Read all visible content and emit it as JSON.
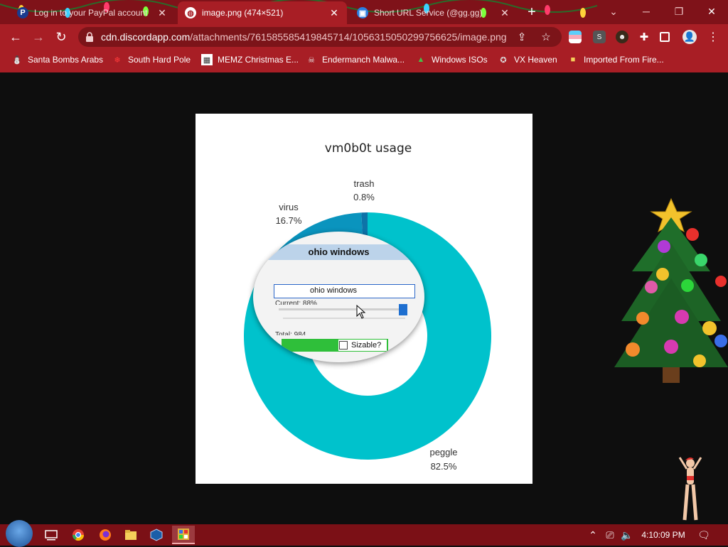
{
  "tabs": [
    {
      "title": "Log in to your PayPal account",
      "favicon": "paypal-favicon",
      "active": false
    },
    {
      "title": "image.png (474×521)",
      "favicon": "globe-favicon",
      "active": true
    },
    {
      "title": "Short URL Service (@gg.gg)",
      "favicon": "shorturl-favicon",
      "active": false
    }
  ],
  "address_bar": {
    "host": "cdn.discordapp.com",
    "path": "/attachments/761585585419845714/1056315050299756625/image.png"
  },
  "bookmarks": [
    {
      "label": "Santa Bombs Arabs",
      "icon": "santa-icon"
    },
    {
      "label": "South Hard Pole",
      "icon": "snowflake-icon"
    },
    {
      "label": "MEMZ Christmas E...",
      "icon": "memz-icon"
    },
    {
      "label": "Endermanch Malwa...",
      "icon": "skull-icon"
    },
    {
      "label": "Windows ISOs",
      "icon": "tree-icon"
    },
    {
      "label": "VX Heaven",
      "icon": "vx-icon"
    },
    {
      "label": "Imported From Fire...",
      "icon": "folder-icon"
    }
  ],
  "colors": {
    "chrome_red": "#a81e25",
    "tab_strip": "#7f1219",
    "taskbar": "#7b1016",
    "peggle": "#00c2cc",
    "virus": "#0a94be",
    "trash": "#0d73a8"
  },
  "chart_data": {
    "type": "pie",
    "variant": "donut",
    "title": "vm0b0t usage",
    "slices": [
      {
        "label": "peggle",
        "value": 82.5,
        "display": "82.5%"
      },
      {
        "label": "virus",
        "value": 16.7,
        "display": "16.7%"
      },
      {
        "label": "trash",
        "value": 0.8,
        "display": "0.8%"
      }
    ]
  },
  "magnifier": {
    "title": "ohio windows",
    "input_value": "ohio windows",
    "current_label": "Current: 88%",
    "total_label": "Total: 984",
    "checkbox_label": "Sizable?",
    "slider_fraction": 0.97
  },
  "taskbar": {
    "clock": "4:10:09 PM",
    "apps": [
      "task-view-icon",
      "chrome-icon",
      "firefox-icon",
      "file-explorer-icon",
      "virtualbox-icon",
      "app-window-icon"
    ]
  }
}
